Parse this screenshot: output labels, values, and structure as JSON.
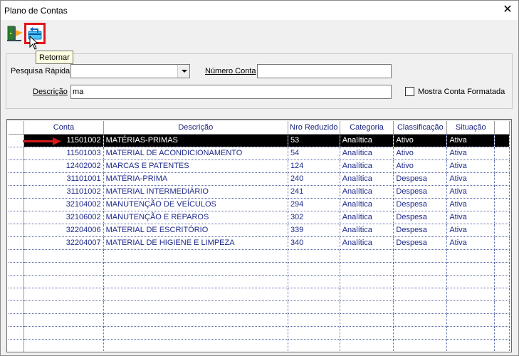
{
  "window": {
    "title": "Plano de Contas",
    "close_glyph": "✕"
  },
  "toolbar": {
    "exit_icon": "exit-door-icon",
    "return_icon": "return-card-icon",
    "tooltip": "Retornar"
  },
  "search": {
    "quick_label": "Pesquisa Rápida",
    "quick_value": "",
    "account_label": "Número Conta",
    "account_value": "",
    "description_label": "Descrição",
    "description_value": "ma",
    "formatted_label": "Mostra Conta Formatada",
    "formatted_checked": false
  },
  "grid": {
    "columns": [
      "Conta",
      "Descrição",
      "Nro Reduzido",
      "Categoria",
      "Classificação",
      "Situação"
    ],
    "rows": [
      {
        "conta": "11501002",
        "descricao": "MATÉRIAS-PRIMAS",
        "reduzido": "53",
        "categoria": "Analítica",
        "classificacao": "Ativo",
        "situacao": "Ativa",
        "selected": true
      },
      {
        "conta": "11501003",
        "descricao": "MATERIAL DE ACONDICIONAMENTO",
        "reduzido": "54",
        "categoria": "Analítica",
        "classificacao": "Ativo",
        "situacao": "Ativa"
      },
      {
        "conta": "12402002",
        "descricao": "MARCAS E PATENTES",
        "reduzido": "124",
        "categoria": "Analítica",
        "classificacao": "Ativo",
        "situacao": "Ativa"
      },
      {
        "conta": "31101001",
        "descricao": "MATÉRIA-PRIMA",
        "reduzido": "240",
        "categoria": "Analítica",
        "classificacao": "Despesa",
        "situacao": "Ativa"
      },
      {
        "conta": "31101002",
        "descricao": "MATERIAL INTERMEDIÁRIO",
        "reduzido": "241",
        "categoria": "Analítica",
        "classificacao": "Despesa",
        "situacao": "Ativa"
      },
      {
        "conta": "32104002",
        "descricao": "MANUTENÇÃO DE VEÍCULOS",
        "reduzido": "294",
        "categoria": "Analítica",
        "classificacao": "Despesa",
        "situacao": "Ativa"
      },
      {
        "conta": "32106002",
        "descricao": "MANUTENÇÃO E REPAROS",
        "reduzido": "302",
        "categoria": "Analítica",
        "classificacao": "Despesa",
        "situacao": "Ativa"
      },
      {
        "conta": "32204006",
        "descricao": "MATERIAL DE ESCRITÓRIO",
        "reduzido": "339",
        "categoria": "Analítica",
        "classificacao": "Despesa",
        "situacao": "Ativa"
      },
      {
        "conta": "32204007",
        "descricao": "MATERIAL DE HIGIENE E LIMPEZA",
        "reduzido": "340",
        "categoria": "Analítica",
        "classificacao": "Despesa",
        "situacao": "Ativa"
      }
    ],
    "empty_rows": 8,
    "colors": {
      "text": "#1e2a8c",
      "header_text": "#1a237e",
      "selected_bg": "#000000",
      "selected_text": "#ffffff",
      "arrow": "#d7191c",
      "highlight": "#e0161b"
    }
  }
}
